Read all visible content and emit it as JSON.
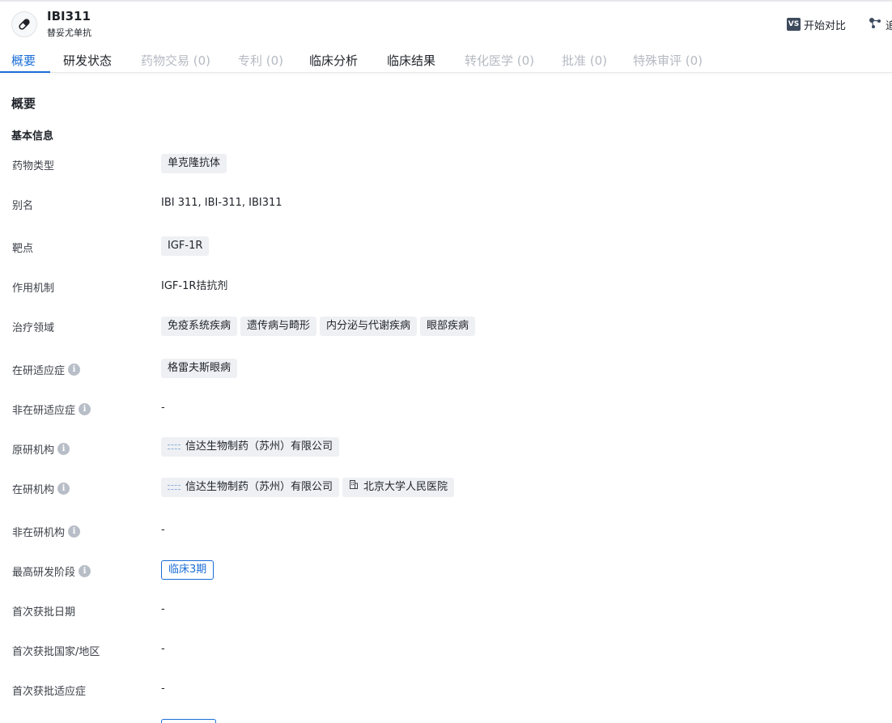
{
  "drug": {
    "name": "IBI311",
    "generic_name": "替妥尤单抗"
  },
  "header_actions": {
    "compare_badge": "VS",
    "compare_label": "开始对比",
    "more_label": "追"
  },
  "tabs": [
    {
      "label": "概要",
      "state": "active"
    },
    {
      "label": "研发状态",
      "state": "normal"
    },
    {
      "label": "药物交易 (0)",
      "state": "disabled"
    },
    {
      "label": "专利 (0)",
      "state": "disabled"
    },
    {
      "label": "临床分析",
      "state": "normal"
    },
    {
      "label": "临床结果",
      "state": "normal"
    },
    {
      "label": "转化医学 (0)",
      "state": "disabled"
    },
    {
      "label": "批准 (0)",
      "state": "disabled"
    },
    {
      "label": "特殊审评 (0)",
      "state": "disabled"
    }
  ],
  "section_title": "概要",
  "group_title": "基本信息",
  "info_glyph": "i",
  "rows": {
    "drug_type": {
      "label": "药物类型",
      "tags": [
        "单克隆抗体"
      ]
    },
    "alias": {
      "label": "别名",
      "value": "IBI 311, IBI-311, IBI311"
    },
    "target": {
      "label": "靶点",
      "tags": [
        "IGF-1R"
      ]
    },
    "mechanism": {
      "label": "作用机制",
      "value": "IGF-1R拮抗剂"
    },
    "therapeutic_area": {
      "label": "治疗领域",
      "tags": [
        "免疫系统疾病",
        "遗传病与畸形",
        "内分泌与代谢疾病",
        "眼部疾病"
      ]
    },
    "active_indication": {
      "label": "在研适应症",
      "tags": [
        "格雷夫斯眼病"
      ]
    },
    "inactive_indication": {
      "label": "非在研适应症",
      "value": "-"
    },
    "originator": {
      "label": "原研机构",
      "orgs": [
        "信达生物制药（苏州）有限公司"
      ]
    },
    "active_org": {
      "label": "在研机构",
      "orgs": [
        "信达生物制药（苏州）有限公司",
        "北京大学人民医院"
      ]
    },
    "inactive_org": {
      "label": "非在研机构",
      "value": "-"
    },
    "highest_phase": {
      "label": "最高研发阶段",
      "phase": "临床3期"
    },
    "first_approval_date": {
      "label": "首次获批日期",
      "value": "-"
    },
    "first_approval_country": {
      "label": "首次获批国家/地区",
      "value": "-"
    },
    "first_approval_indication": {
      "label": "首次获批适应症",
      "value": "-"
    }
  },
  "colors": {
    "accent": "#1a6dd6",
    "disabled_tab": "#b5bac2",
    "tag_bg": "#eef0f3",
    "info_icon": "#b8bec7"
  }
}
